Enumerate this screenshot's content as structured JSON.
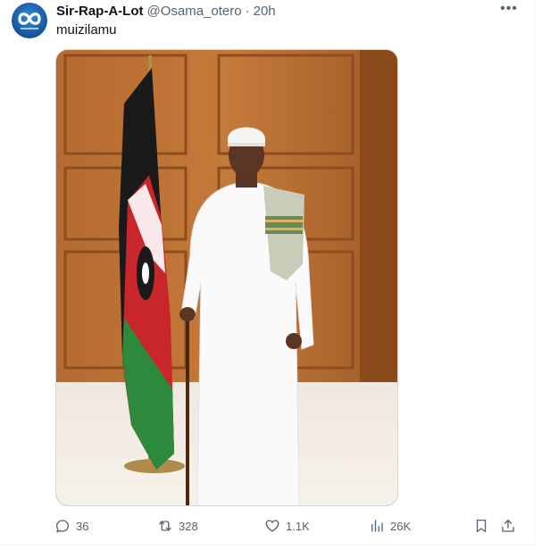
{
  "tweet": {
    "author_name": "Sir-Rap-A-Lot",
    "handle": "@Osama_otero",
    "separator": "·",
    "time": "20h",
    "text": "muizilamu",
    "more_icon": "more-horizontal-icon"
  },
  "media": {
    "type": "photo"
  },
  "actions": {
    "replies": "36",
    "retweets": "328",
    "likes": "1.1K",
    "views": "26K"
  },
  "colors": {
    "text_primary": "#0f1419",
    "text_secondary": "#536471",
    "border": "#cfd9de"
  }
}
